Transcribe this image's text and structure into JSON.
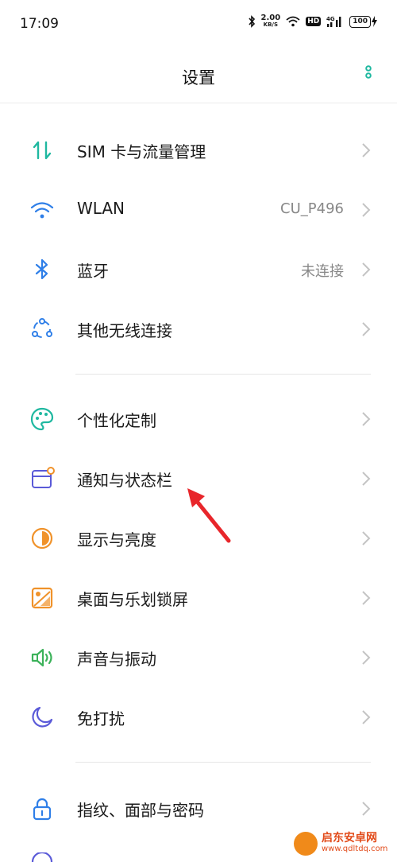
{
  "status_bar": {
    "time": "17:09",
    "speed_value": "2.00",
    "speed_unit": "KB/S",
    "network_badge": "HD",
    "signal_label": "4G",
    "battery_level": "100"
  },
  "header": {
    "title": "设置",
    "more_icon": "more-vertical-icon"
  },
  "groups": [
    [
      {
        "label": "SIM 卡与流量管理",
        "icon": "sim-data-icon",
        "value": ""
      },
      {
        "label": "WLAN",
        "icon": "wifi-icon",
        "value": "CU_P496"
      },
      {
        "label": "蓝牙",
        "icon": "bluetooth-icon",
        "value": "未连接"
      },
      {
        "label": "其他无线连接",
        "icon": "wireless-connections-icon",
        "value": ""
      }
    ],
    [
      {
        "label": "个性化定制",
        "icon": "palette-icon",
        "value": ""
      },
      {
        "label": "通知与状态栏",
        "icon": "notification-icon",
        "value": ""
      },
      {
        "label": "显示与亮度",
        "icon": "brightness-icon",
        "value": ""
      },
      {
        "label": "桌面与乐划锁屏",
        "icon": "wallpaper-icon",
        "value": ""
      },
      {
        "label": "声音与振动",
        "icon": "sound-icon",
        "value": ""
      },
      {
        "label": "免打扰",
        "icon": "moon-icon",
        "value": ""
      }
    ],
    [
      {
        "label": "指纹、面部与密码",
        "icon": "lock-icon",
        "value": ""
      }
    ]
  ],
  "watermark": {
    "name": "启东安卓网",
    "url": "www.qdltdq.com"
  },
  "colors": {
    "teal": "#1fb8a0",
    "blue": "#2f7fe8",
    "orange": "#f0922a",
    "green": "#3cb25a",
    "purple": "#5a5ad8",
    "arrow": "#e8262b"
  }
}
